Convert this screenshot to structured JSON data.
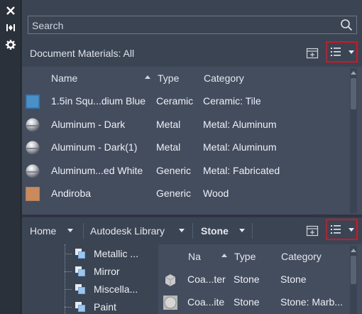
{
  "search": {
    "placeholder": "Search"
  },
  "document": {
    "title": "Document Materials: All",
    "columns": {
      "name": "Name",
      "type": "Type",
      "category": "Category"
    },
    "rows": [
      {
        "name": "1.5in Squ...dium Blue",
        "type": "Ceramic",
        "category": "Ceramic: Tile",
        "swatch": "blue-tile"
      },
      {
        "name": "Aluminum - Dark",
        "type": "Metal",
        "category": "Metal: Aluminum",
        "swatch": "metal-sphere"
      },
      {
        "name": "Aluminum - Dark(1)",
        "type": "Metal",
        "category": "Metal: Aluminum",
        "swatch": "metal-sphere"
      },
      {
        "name": "Aluminum...ed White",
        "type": "Generic",
        "category": "Metal: Fabricated",
        "swatch": "metal-sphere"
      },
      {
        "name": "Andiroba",
        "type": "Generic",
        "category": "Wood",
        "swatch": "wood"
      }
    ]
  },
  "library": {
    "breadcrumb": {
      "home": "Home",
      "library": "Autodesk Library",
      "folder": "Stone"
    },
    "tree": [
      {
        "label": "Metallic ..."
      },
      {
        "label": "Mirror"
      },
      {
        "label": "Miscella..."
      },
      {
        "label": "Paint"
      }
    ],
    "columns": {
      "name": "Na",
      "type": "Type",
      "category": "Category"
    },
    "rows": [
      {
        "name": "Coa...ter",
        "type": "Stone",
        "category": "Stone",
        "swatch": "stone-cube"
      },
      {
        "name": "Coa...ite",
        "type": "Stone",
        "category": "Stone: Marb...",
        "swatch": "stone-sphere"
      }
    ]
  },
  "icons": {
    "strip": [
      "close-icon",
      "collapse-icon",
      "settings-icon"
    ],
    "toolbar": [
      "create-material-icon",
      "list-view-icon"
    ]
  },
  "colors": {
    "highlight": "#e0101c",
    "panel": "#3b4453",
    "table": "#434d5e"
  }
}
